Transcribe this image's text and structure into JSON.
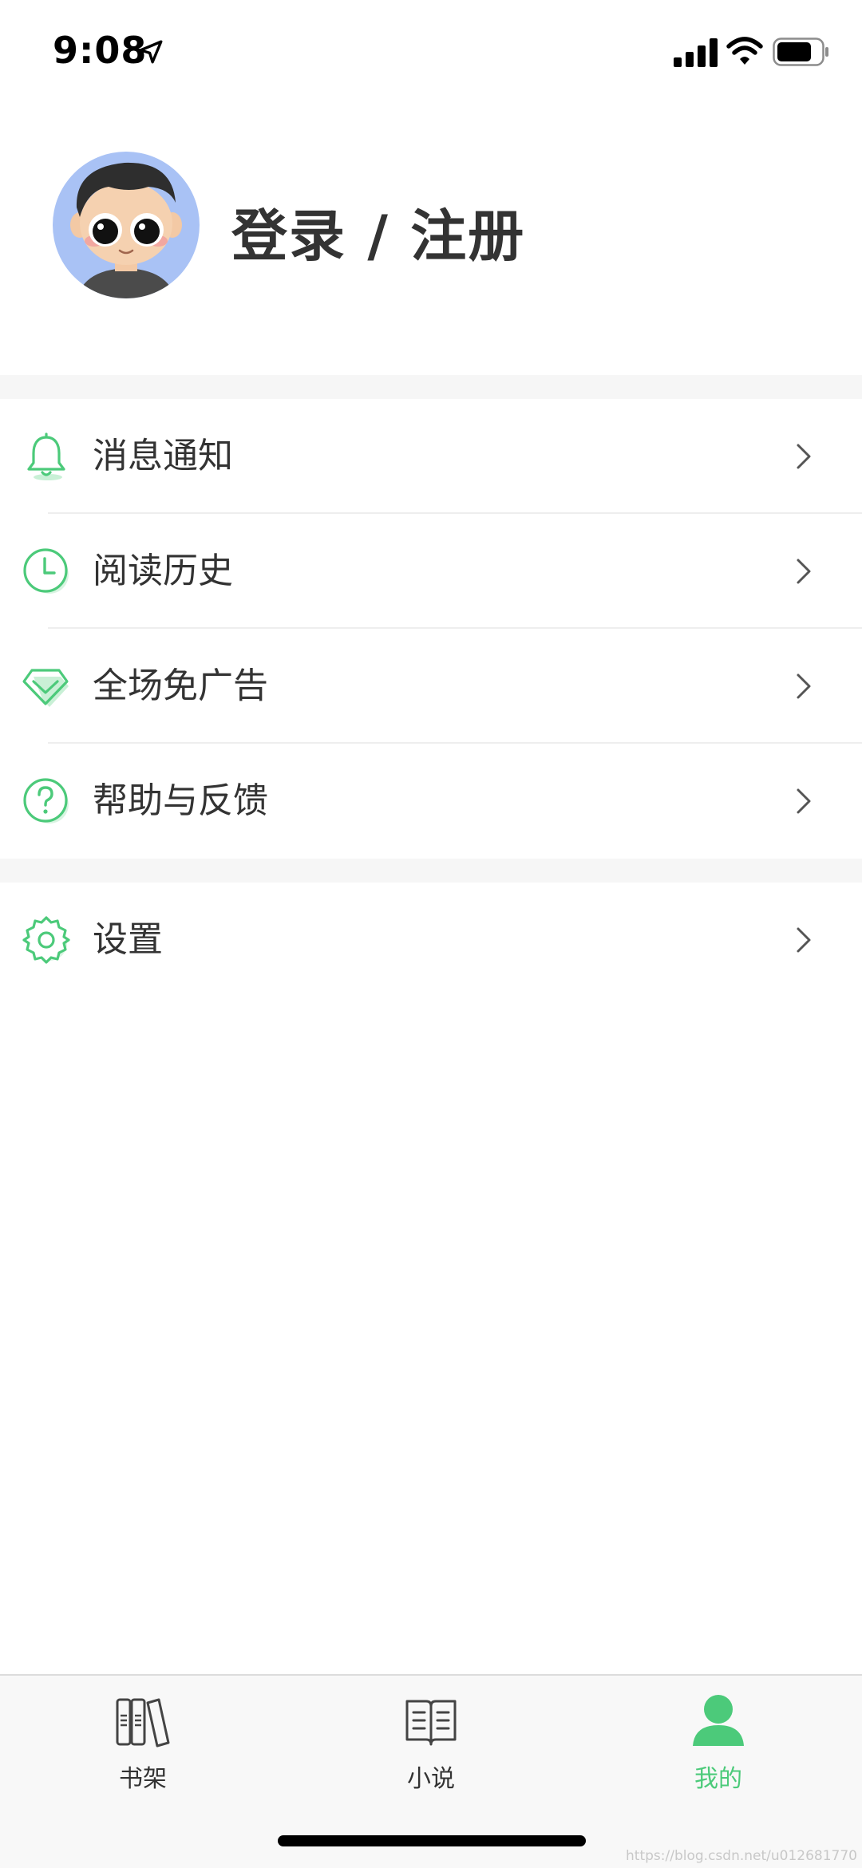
{
  "status_bar": {
    "time": "9:08",
    "icons": [
      "location-arrow-icon",
      "cellular-signal-icon",
      "wifi-icon",
      "battery-icon"
    ]
  },
  "profile": {
    "login_label": "登录 / 注册",
    "avatar_icon": "avatar-cartoon-boy"
  },
  "menu": {
    "items": [
      {
        "label": "消息通知",
        "icon": "bell-icon"
      },
      {
        "label": "阅读历史",
        "icon": "clock-icon"
      },
      {
        "label": "全场免广告",
        "icon": "diamond-icon"
      },
      {
        "label": "帮助与反馈",
        "icon": "help-question-icon"
      }
    ],
    "settings": {
      "label": "设置",
      "icon": "gear-icon"
    }
  },
  "tab_bar": {
    "tabs": [
      {
        "label": "书架",
        "icon": "bookshelf-icon",
        "active": false
      },
      {
        "label": "小说",
        "icon": "open-book-icon",
        "active": false
      },
      {
        "label": "我的",
        "icon": "user-icon",
        "active": true
      }
    ]
  },
  "watermark": "https://blog.csdn.net/u012681770",
  "colors": {
    "accent": "#4cca7a",
    "text": "#333333",
    "section_gap": "#f6f6f6",
    "tab_bar_bg": "#f8f8f8"
  }
}
